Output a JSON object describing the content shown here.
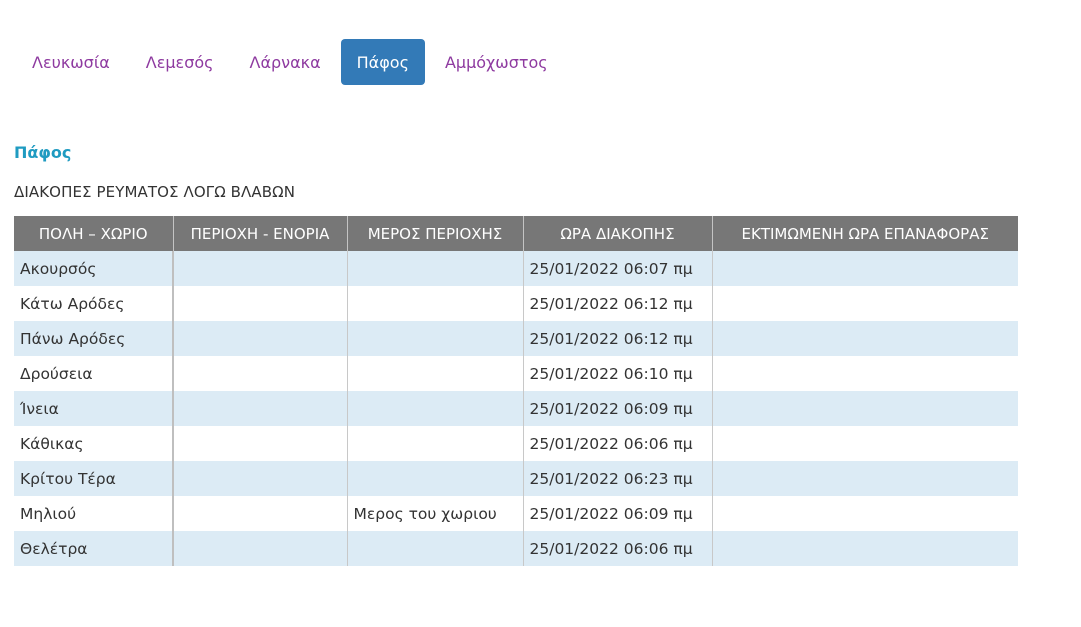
{
  "tabs": [
    {
      "label": "Λευκωσία",
      "active": false
    },
    {
      "label": "Λεμεσός",
      "active": false
    },
    {
      "label": "Λάρνακα",
      "active": false
    },
    {
      "label": "Πάφος",
      "active": true
    },
    {
      "label": "Αμμόχωστος",
      "active": false
    }
  ],
  "section": {
    "title": "Πάφος",
    "subtitle": "ΔΙΑΚΟΠΕΣ ΡΕΥΜΑΤΟΣ ΛΟΓΩ ΒΛΑΒΩΝ"
  },
  "table": {
    "headers": [
      "ΠΟΛΗ – ΧΩΡΙΟ",
      "ΠΕΡΙΟΧΗ - ΕΝΟΡΙΑ",
      "ΜΕΡΟΣ ΠΕΡΙΟΧΗΣ",
      "ΩΡΑ ΔΙΑΚΟΠΗΣ",
      "ΕΚΤΙΜΩΜΕΝΗ ΩΡΑ ΕΠΑΝΑΦΟΡΑΣ"
    ],
    "rows": [
      [
        "Ακουρσός",
        "",
        "",
        "25/01/2022 06:07 πμ",
        ""
      ],
      [
        "Κάτω Αρόδες",
        "",
        "",
        "25/01/2022 06:12 πμ",
        ""
      ],
      [
        "Πάνω Αρόδες",
        "",
        "",
        "25/01/2022 06:12 πμ",
        ""
      ],
      [
        "Δρούσεια",
        "",
        "",
        "25/01/2022 06:10 πμ",
        ""
      ],
      [
        "Ίνεια",
        "",
        "",
        "25/01/2022 06:09 πμ",
        ""
      ],
      [
        "Κάθικας",
        "",
        "",
        "25/01/2022 06:06 πμ",
        ""
      ],
      [
        "Κρίτου Τέρα",
        "",
        "",
        "25/01/2022 06:23 πμ",
        ""
      ],
      [
        "Μηλιού",
        "",
        "Μερος του χωριου",
        "25/01/2022 06:09 πμ",
        ""
      ],
      [
        "Θελέτρα",
        "",
        "",
        "25/01/2022 06:06 πμ",
        ""
      ]
    ]
  },
  "colors": {
    "tab_text": "#8e3aa0",
    "tab_active_bg": "#337ab7",
    "section_title": "#1f9bc1",
    "header_bg": "#777777",
    "row_stripe": "#dcebf5"
  }
}
